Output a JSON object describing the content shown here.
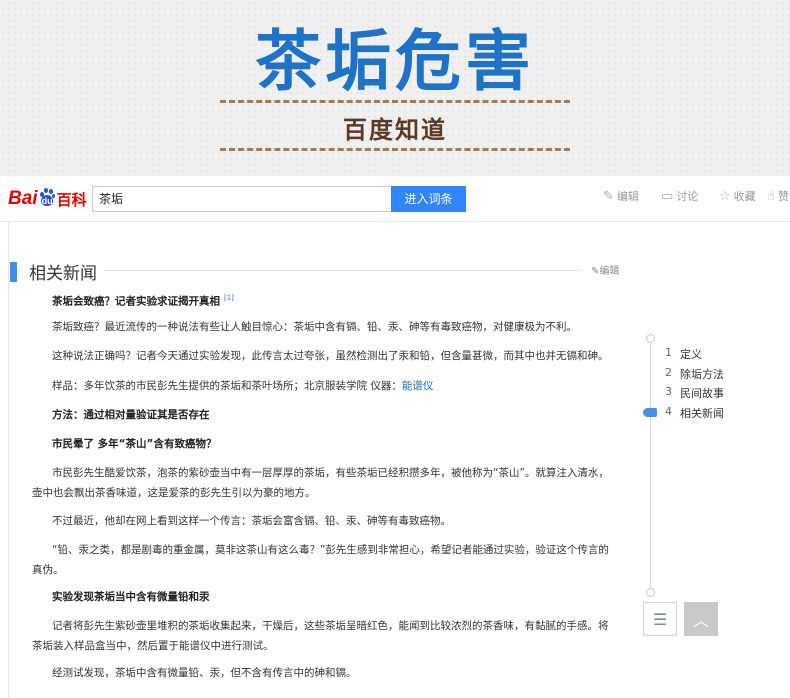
{
  "banner": {
    "title": "茶垢危害",
    "subtitle": "百度知道"
  },
  "toolbar": {
    "logo_bai": "Bai",
    "logo_du": "du",
    "logo_baike": "百科",
    "search_value": "茶垢",
    "search_button": "进入词条",
    "actions": [
      {
        "icon": "edit-icon",
        "label": "编辑"
      },
      {
        "icon": "discuss-icon",
        "label": "讨论"
      },
      {
        "icon": "star-icon",
        "label": "收藏"
      },
      {
        "icon": "like-icon",
        "label": "赞"
      }
    ]
  },
  "section": {
    "title": "相关新闻",
    "edit": "编辑"
  },
  "article": {
    "headline": "茶垢会致癌？记者实验求证揭开真相",
    "ref": "[1]",
    "p1": "茶垢致癌？最近流传的一种说法有些让人触目惊心：茶垢中含有镉、铅、汞、砷等有毒致癌物，对健康极为不利。",
    "p2": "这种说法正确吗？记者今天通过实验发现，此传言太过夸张，虽然检测出了汞和铅，但含量甚微，而其中也并无镉和砷。",
    "p3_text": "样品：多年饮茶的市民彭先生提供的茶垢和茶叶场所；北京服装学院 仪器：",
    "p3_link": "能谱仪",
    "method": "方法：通过相对量验证其是否存在",
    "sub1": "市民晕了 多年“茶山”含有致癌物？",
    "p4": "市民彭先生酷爱饮茶，泡茶的紫砂壶当中有一层厚厚的茶垢，有些茶垢已经积攒多年，被他称为“茶山”。就算注入清水，壶中也会飘出茶香味道，这是爱茶的彭先生引以为豪的地方。",
    "p5": "不过最近，他却在网上看到这样一个传言：茶垢会富含镉、铅、汞、砷等有毒致癌物。",
    "p6": "“铅、汞之类，都是剧毒的重金属，莫非这茶山有这么毒？”彭先生感到非常担心，希望记者能通过实验，验证这个传言的真伪。",
    "sub2": "实验发现茶垢当中含有微量铅和汞",
    "p7": "记者将彭先生紫砂壶里堆积的茶垢收集起来，干燥后，这些茶垢呈暗红色，能闻到比较浓烈的茶香味，有黏腻的手感。将茶垢装入样品盒当中，然后置于能谱仪中进行测试。",
    "p8": "经测试发现，茶垢中含有微量铅、汞，但不含有传言中的砷和镉。"
  },
  "toc": {
    "items": [
      {
        "num": "1",
        "label": "定义"
      },
      {
        "num": "2",
        "label": "除垢方法"
      },
      {
        "num": "3",
        "label": "民间故事"
      },
      {
        "num": "4",
        "label": "相关新闻"
      }
    ],
    "active_index": 3,
    "list_icon": "list-icon",
    "top_icon": "back-to-top-icon"
  },
  "colors": {
    "accent": "#3385ff",
    "banner_title": "#1e72c8",
    "logo_red": "#e10602",
    "link": "#136ec2"
  }
}
